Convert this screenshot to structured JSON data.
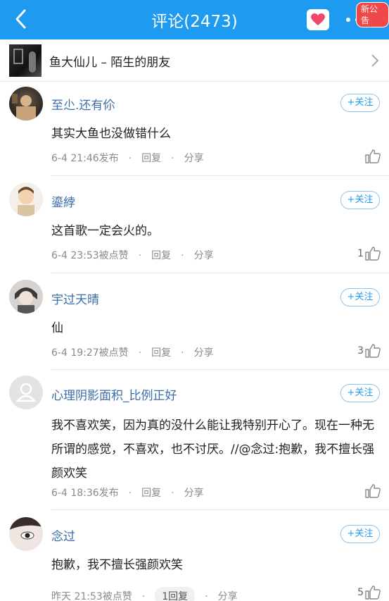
{
  "header": {
    "title": "评论(2473)",
    "badge": "新公告",
    "accent": "#1e9bf0"
  },
  "song": {
    "title": "鱼大仙儿 – 陌生的朋友"
  },
  "follow_label": "+关注",
  "reply_label": "回复",
  "share_label": "分享",
  "comments": [
    {
      "user": "至尐.还有伱",
      "text": "其实大鱼也没做错什么",
      "time": "6-4 21:46发布",
      "likes": ""
    },
    {
      "user": "鎏綍",
      "text": "这首歌一定会火的。",
      "time": "6-4 23:53被点赞",
      "likes": "1"
    },
    {
      "user": "宇过天晴",
      "text": "仙",
      "time": "6-4 19:27被点赞",
      "likes": "3"
    },
    {
      "user": "心理阴影面积_比例正好",
      "text": "我不喜欢笑，因为真的没什么能让我特别开心了。现在一种无所谓的感觉，不喜欢，也不讨厌。//@念过:抱歉，我不擅长强颜欢笑",
      "time": "6-4 18:36发布",
      "likes": ""
    },
    {
      "user": "念过",
      "text": "抱歉，我不擅长强颜欢笑",
      "time": "昨天 21:53被点赞",
      "reply_count": "1回复",
      "likes": "5"
    }
  ]
}
